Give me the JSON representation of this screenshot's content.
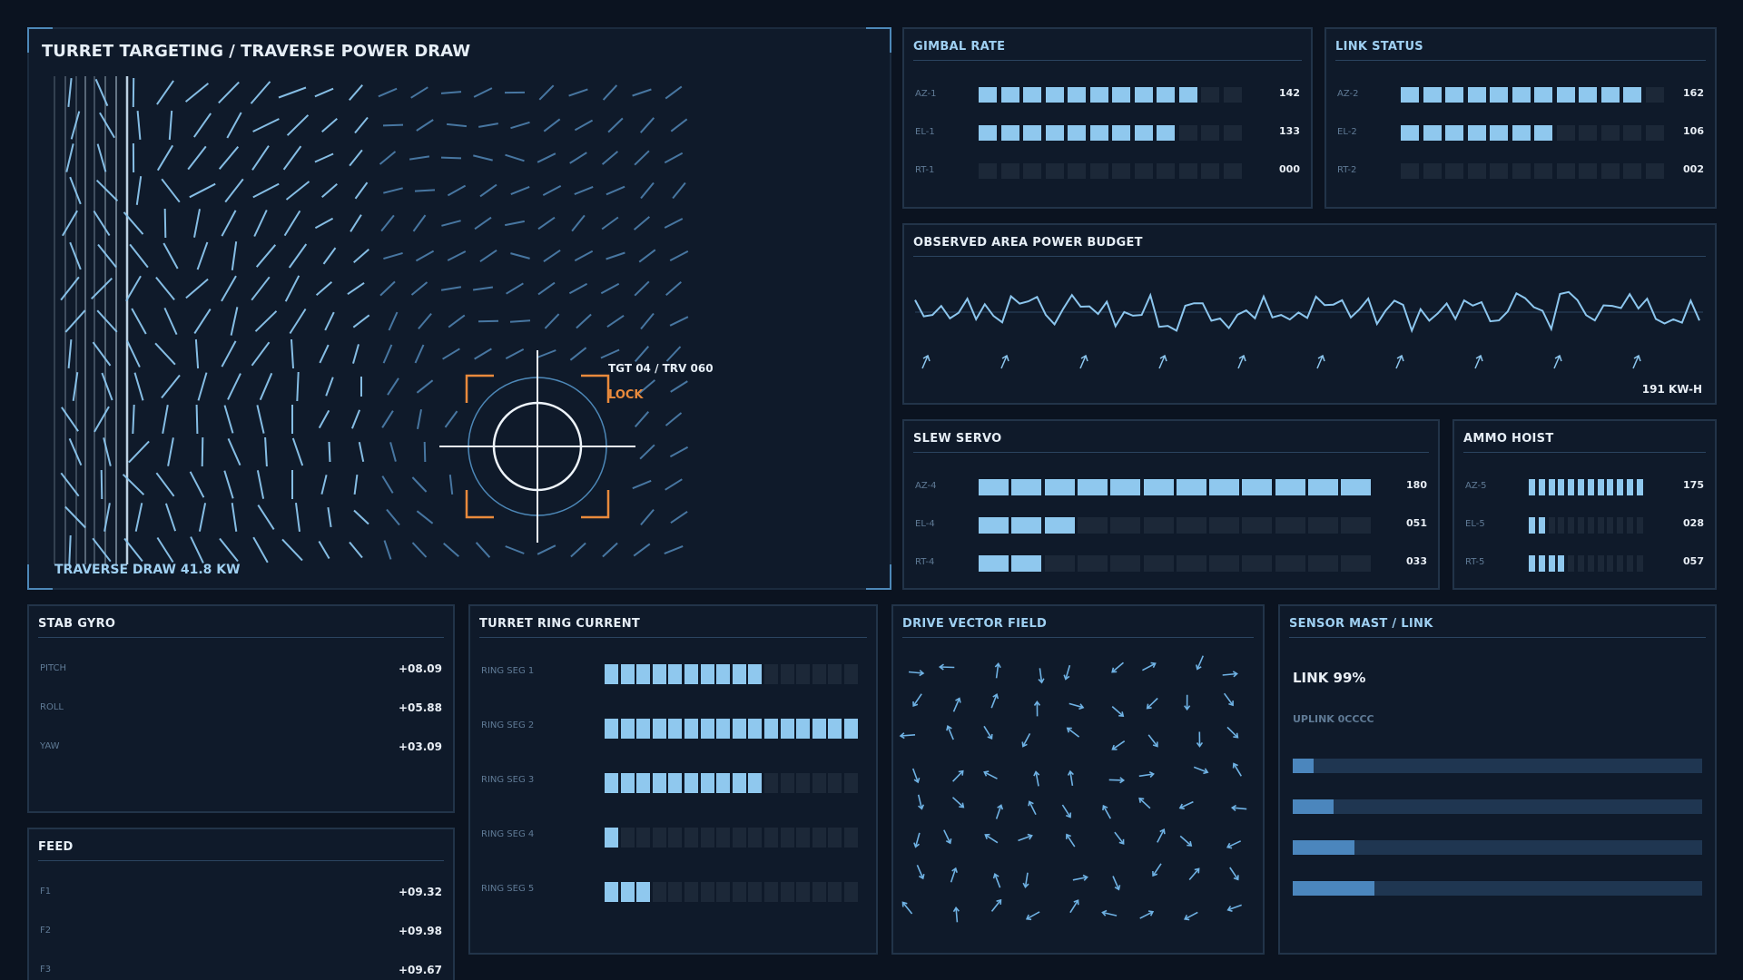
{
  "targeting": {
    "title": "TURRET TARGETING / TRAVERSE POWER DRAW",
    "reticle_label": "TGT 04 / TRV 060",
    "lock_label": "LOCK",
    "footer": "TRAVERSE DRAW 41.8 KW"
  },
  "gimbal": {
    "title": "GIMBAL RATE",
    "rows": [
      {
        "label": "AZ-1",
        "value": "142",
        "fill": 0.83
      },
      {
        "label": "EL-1",
        "value": "133",
        "fill": 0.75
      },
      {
        "label": "RT-1",
        "value": "000",
        "fill": 0.0
      }
    ]
  },
  "link_status": {
    "title": "LINK STATUS",
    "rows": [
      {
        "label": "AZ-2",
        "value": "162",
        "fill": 0.92
      },
      {
        "label": "EL-2",
        "value": "106",
        "fill": 0.58
      },
      {
        "label": "RT-2",
        "value": "002",
        "fill": 0.0
      }
    ]
  },
  "power_budget": {
    "title": "OBSERVED AREA POWER BUDGET",
    "readout": "191 KW-H"
  },
  "slew": {
    "title": "SLEW SERVO",
    "rows": [
      {
        "label": "AZ-4",
        "value": "180",
        "fill": 1.0
      },
      {
        "label": "EL-4",
        "value": "051",
        "fill": 0.25
      },
      {
        "label": "RT-4",
        "value": "033",
        "fill": 0.17
      }
    ]
  },
  "ammo": {
    "title": "AMMO HOIST",
    "rows": [
      {
        "label": "AZ-5",
        "value": "175",
        "fill": 1.0
      },
      {
        "label": "EL-5",
        "value": "028",
        "fill": 0.17
      },
      {
        "label": "RT-5",
        "value": "057",
        "fill": 0.33
      }
    ]
  },
  "stab": {
    "title": "STAB GYRO",
    "rows": [
      {
        "label": "PITCH",
        "value": "+08.09"
      },
      {
        "label": "ROLL",
        "value": "+05.88"
      },
      {
        "label": "YAW",
        "value": "+03.09"
      }
    ]
  },
  "feed": {
    "title": "FEED",
    "rows": [
      {
        "label": "F1",
        "value": "+09.32"
      },
      {
        "label": "F2",
        "value": "+09.98"
      },
      {
        "label": "F3",
        "value": "+09.67"
      }
    ]
  },
  "ring": {
    "title": "TURRET RING CURRENT",
    "rows": [
      {
        "label": "RING SEG 1",
        "fill": 0.6
      },
      {
        "label": "RING SEG 2",
        "fill": 1.0
      },
      {
        "label": "RING SEG 3",
        "fill": 0.6
      },
      {
        "label": "RING SEG 4",
        "fill": 0.07
      },
      {
        "label": "RING SEG 5",
        "fill": 0.2
      }
    ]
  },
  "drive": {
    "title": "DRIVE VECTOR FIELD"
  },
  "mast": {
    "title": "SENSOR MAST / LINK",
    "link": "LINK 99%",
    "uplink": "UPLINK 0CCCC",
    "bars": [
      0.05,
      0.1,
      0.15,
      0.2
    ]
  },
  "colors": {
    "accent": "#8fc8ee",
    "lock": "#e98a3c",
    "panel_border": "#223449"
  }
}
